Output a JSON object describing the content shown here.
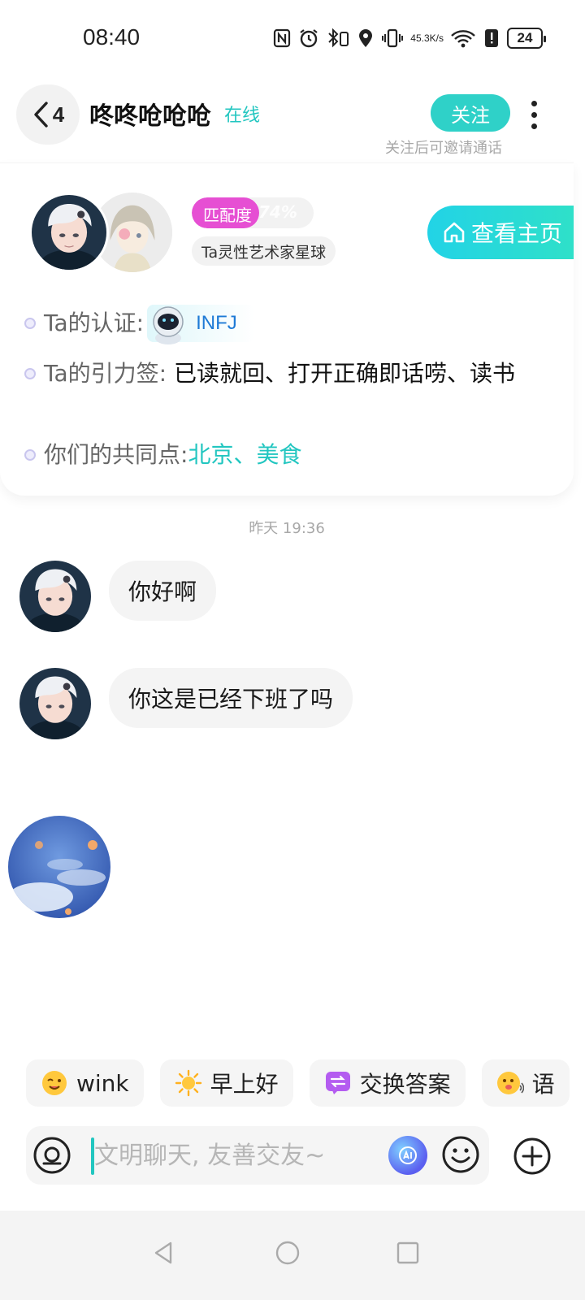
{
  "status_bar": {
    "time": "08:40",
    "net_speed_value": "45.3",
    "net_speed_unit": "K/s",
    "battery": "24",
    "icons": [
      "nfc-icon",
      "alarm-icon",
      "bluetooth-icon",
      "location-icon",
      "vibrate-icon",
      "wifi-icon",
      "alert-icon",
      "battery-icon"
    ]
  },
  "header": {
    "back_count": "4",
    "username": "咚咚呛呛呛",
    "online_status": "在线",
    "follow_label": "关注",
    "follow_hint": "关注后可邀请通话"
  },
  "profile": {
    "match_label": "匹配度",
    "match_value": "74%",
    "match_fraction": 0.55,
    "planet_tag": "Ta灵性艺术家星球",
    "homepage_label": "查看主页",
    "certification_label": "Ta的认证:",
    "mbti": "INFJ",
    "tags_label": "Ta的引力签:",
    "tags_value": "已读就回、打开正确即话唠、读书",
    "common_label": "你们的共同点:",
    "common_value": "北京、美食"
  },
  "chat": {
    "timestamp": "昨天 19:36",
    "messages": [
      {
        "text": "你好啊"
      },
      {
        "text": "你这是已经下班了吗"
      }
    ]
  },
  "quick_replies": [
    {
      "label": "wink",
      "icon": "wink-emoji-icon"
    },
    {
      "label": "早上好",
      "icon": "sun-icon"
    },
    {
      "label": "交换答案",
      "icon": "exchange-icon"
    },
    {
      "label": "语",
      "icon": "voice-emoji-icon"
    }
  ],
  "input": {
    "placeholder": "文明聊天, 友善交友~"
  },
  "colors": {
    "accent": "#22c6c0",
    "match": "#e64fd3",
    "mbti": "#1e7ad6"
  }
}
